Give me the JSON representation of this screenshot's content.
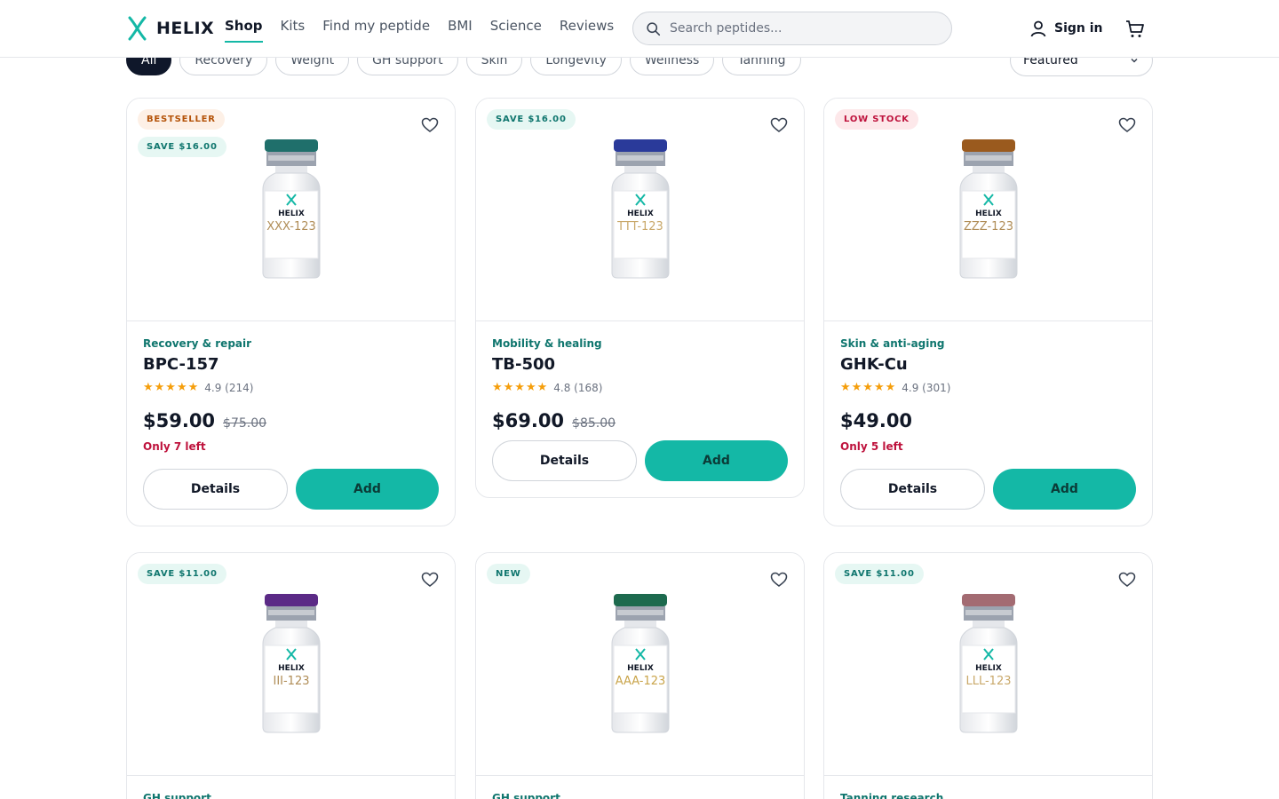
{
  "brand": {
    "name": "HELIX",
    "accent": "#14b8a6"
  },
  "nav": [
    "Shop",
    "Kits",
    "Find my peptide",
    "BMI",
    "Science",
    "Reviews"
  ],
  "search": {
    "placeholder": "Search peptides..."
  },
  "account": {
    "signin_label": "Sign in"
  },
  "filters": {
    "chips": [
      "All",
      "Recovery",
      "Weight",
      "GH support",
      "Skin",
      "Longevity",
      "Wellness",
      "Tanning"
    ],
    "sort_label": "Featured"
  },
  "products": [
    {
      "badges": [
        {
          "text": "BESTSELLER",
          "kind": "bestseller"
        },
        {
          "text": "SAVE $16.00",
          "kind": "save"
        }
      ],
      "vial_label": "XXX-123",
      "cap_color": "#1f6f6b",
      "label_color": "#b08d57",
      "category": "Recovery & repair",
      "name": "BPC-157",
      "stars": "★★★★★",
      "rating": "4.9 (214)",
      "price": "$59.00",
      "old_price": "$75.00",
      "stock": "Only 7 left",
      "details_label": "Details",
      "add_label": "Add"
    },
    {
      "badges": [
        {
          "text": "SAVE $16.00",
          "kind": "save"
        }
      ],
      "vial_label": "TTT-123",
      "cap_color": "#2a3a9a",
      "label_color": "#c9a86a",
      "category": "Mobility & healing",
      "name": "TB-500",
      "stars": "★★★★★",
      "rating": "4.8 (168)",
      "price": "$69.00",
      "old_price": "$85.00",
      "stock": "",
      "details_label": "Details",
      "add_label": "Add"
    },
    {
      "badges": [
        {
          "text": "LOW STOCK",
          "kind": "low"
        }
      ],
      "vial_label": "ZZZ-123",
      "cap_color": "#9a5a1e",
      "label_color": "#b08d57",
      "category": "Skin & anti-aging",
      "name": "GHK-Cu",
      "stars": "★★★★★",
      "rating": "4.9 (301)",
      "price": "$49.00",
      "old_price": "",
      "stock": "Only 5 left",
      "details_label": "Details",
      "add_label": "Add"
    },
    {
      "badges": [
        {
          "text": "SAVE $11.00",
          "kind": "save"
        }
      ],
      "vial_label": "III-123",
      "cap_color": "#5b2a86",
      "label_color": "#b08d57",
      "category": "GH support",
      "name": "",
      "stars": "",
      "rating": "",
      "price": "",
      "old_price": "",
      "stock": "",
      "details_label": "",
      "add_label": ""
    },
    {
      "badges": [
        {
          "text": "NEW",
          "kind": "new"
        }
      ],
      "vial_label": "AAA-123",
      "cap_color": "#1d6a4e",
      "label_color": "#c9a44a",
      "category": "GH support",
      "name": "",
      "stars": "",
      "rating": "",
      "price": "",
      "old_price": "",
      "stock": "",
      "details_label": "",
      "add_label": ""
    },
    {
      "badges": [
        {
          "text": "SAVE $11.00",
          "kind": "save"
        }
      ],
      "vial_label": "LLL-123",
      "cap_color": "#a36b72",
      "label_color": "#c9a86a",
      "category": "Tanning research",
      "name": "",
      "stars": "",
      "rating": "",
      "price": "",
      "old_price": "",
      "stock": "",
      "details_label": "",
      "add_label": ""
    }
  ]
}
